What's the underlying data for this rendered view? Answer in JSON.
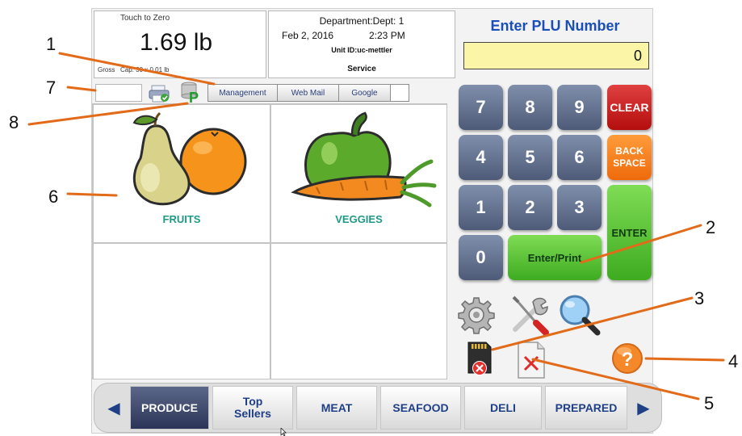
{
  "scale": {
    "touch_label": "Touch to Zero",
    "weight": "1.69 lb",
    "gross_label": "Gross",
    "capacity": "Cap. 30 x 0.01 lb"
  },
  "info": {
    "department": "Department:Dept: 1",
    "date": "Feb 2, 2016",
    "time": "2:23 PM",
    "unit_id": "Unit ID:uc-mettler",
    "mode": "Service"
  },
  "toolbar": {
    "links": [
      "Management",
      "Web Mail",
      "Google"
    ],
    "p_icon_letter": "P"
  },
  "departments": [
    {
      "label": "FRUITS"
    },
    {
      "label": "VEGGIES"
    }
  ],
  "plu": {
    "title": "Enter PLU Number",
    "value": "0"
  },
  "keypad": {
    "digits": [
      "7",
      "8",
      "9",
      "4",
      "5",
      "6",
      "1",
      "2",
      "3",
      "0"
    ],
    "clear": "CLEAR",
    "back_space_1": "BACK",
    "back_space_2": "SPACE",
    "enter": "ENTER",
    "enter_print": "Enter/Print"
  },
  "categories": {
    "produce": "PRODUCE",
    "top_sellers_1": "Top",
    "top_sellers_2": "Sellers",
    "meat": "MEAT",
    "seafood": "SEAFOOD",
    "deli": "DELI",
    "prepared": "PREPARED"
  },
  "callouts": [
    "1",
    "2",
    "3",
    "4",
    "5",
    "6",
    "7",
    "8"
  ],
  "colors": {
    "plu_title": "#1a4fb8",
    "plu_field": "#fbf6a7",
    "key_num": "#5d6a87",
    "key_clear": "#c81c1c",
    "key_back": "#f27a1a",
    "key_green": "#4cbb2b",
    "category_active": "#3a4566",
    "category_text": "#1f3f86",
    "dept_label": "#1e9a86",
    "callout_line": "#e26b1a"
  }
}
